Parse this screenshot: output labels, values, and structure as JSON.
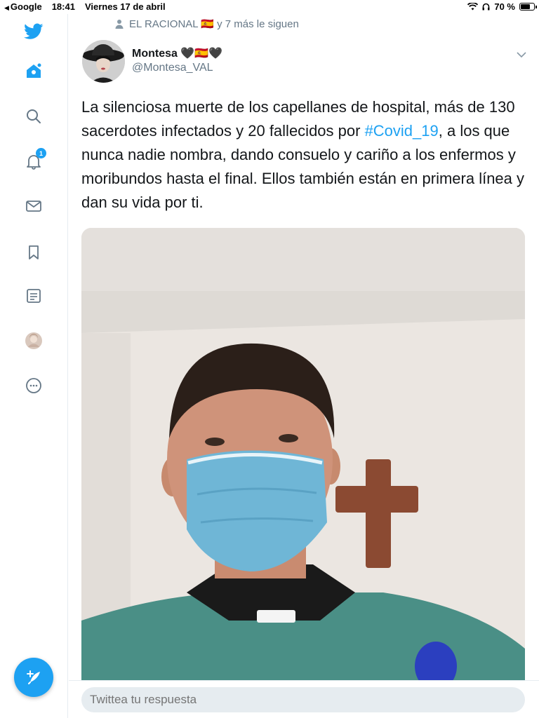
{
  "status_bar": {
    "back_app": "Google",
    "time": "18:41",
    "date": "Viernes 17 de abril",
    "battery": "70 %"
  },
  "sidebar": {
    "items": [
      {
        "name": "twitter-logo-icon"
      },
      {
        "name": "home-icon"
      },
      {
        "name": "search-icon"
      },
      {
        "name": "notifications-icon",
        "badge": "1"
      },
      {
        "name": "messages-icon"
      },
      {
        "name": "bookmarks-icon"
      },
      {
        "name": "lists-icon"
      },
      {
        "name": "profile-avatar-icon"
      },
      {
        "name": "more-icon"
      }
    ],
    "compose_icon": "compose-tweet-icon"
  },
  "tweet": {
    "social_context": "EL RACIONAL 🇪🇸 y 7 más le siguen",
    "author_name": "Montesa 🖤🇪🇸🖤",
    "author_handle": "@Montesa_VAL",
    "text_before": "La silenciosa muerte de los capellanes de hospital, más de 130 sacerdotes infectados y 20 fallecidos por ",
    "hashtag": "#Covid_19",
    "text_after": ", a los que nunca nadie nombra, dando consuelo y cariño a los enfermos y moribundos hasta el final. Ellos también están en primera línea y dan su vida por ti."
  },
  "reply": {
    "placeholder": "Twittea tu respuesta"
  },
  "colors": {
    "accent": "#1da1f2",
    "secondary_text": "#657786",
    "divider": "#e6ecf0"
  }
}
